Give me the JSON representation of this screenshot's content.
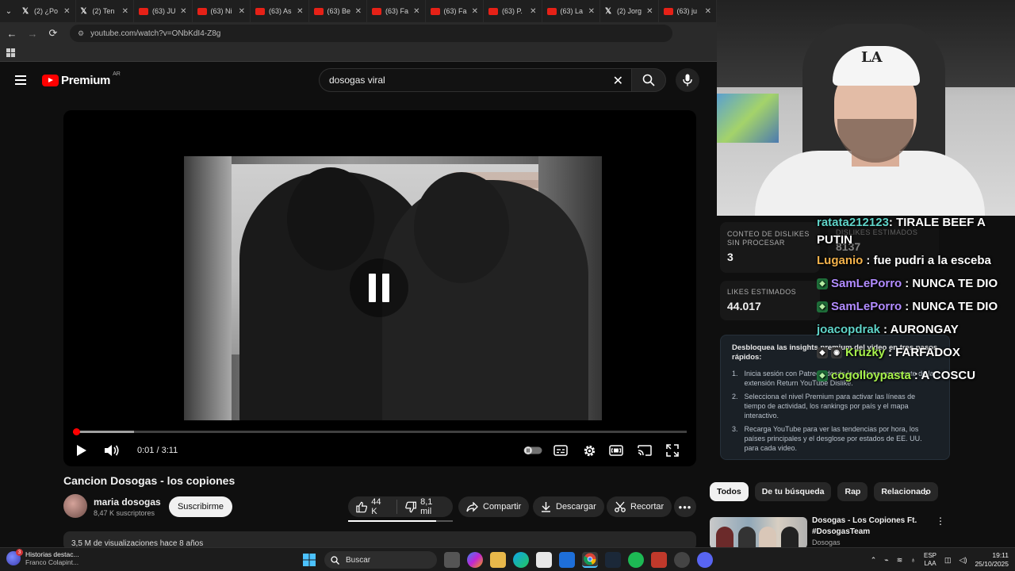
{
  "browser": {
    "tabs": [
      {
        "icon": "x-icon",
        "label": "(2) ¿Po"
      },
      {
        "icon": "x-icon",
        "label": "(2) Ten"
      },
      {
        "icon": "youtube-icon",
        "label": "(63) JU"
      },
      {
        "icon": "youtube-icon",
        "label": "(63) Ni"
      },
      {
        "icon": "youtube-icon",
        "label": "(63) As"
      },
      {
        "icon": "youtube-icon",
        "label": "(63) Be"
      },
      {
        "icon": "youtube-icon",
        "label": "(63) Fa"
      },
      {
        "icon": "youtube-icon",
        "label": "(63) Fa"
      },
      {
        "icon": "youtube-icon",
        "label": "(63) P."
      },
      {
        "icon": "youtube-icon",
        "label": "(63) La"
      },
      {
        "icon": "x-icon",
        "label": "(2) Jorg"
      },
      {
        "icon": "youtube-icon",
        "label": "(63) ju"
      }
    ],
    "url": "youtube.com/watch?v=ONbKdI4-Z8g"
  },
  "youtube": {
    "logo_text": "Premium",
    "country_code": "AR",
    "search_query": "dosogas viral"
  },
  "player": {
    "time_current": "0:01",
    "time_separator": " / ",
    "time_total": "3:11",
    "played_fraction": 0.005,
    "loaded_fraction": 0.1
  },
  "video": {
    "title": "Cancion Dosogas - los copiones",
    "channel_name": "maria dosogas",
    "subscribers": "8,47 K suscriptores",
    "subscribe_label": "Suscribirme",
    "likes": "44 K",
    "dislikes": "8,1 mil",
    "like_ratio": 0.84,
    "share_label": "Compartir",
    "download_label": "Descargar",
    "clip_label": "Recortar",
    "views_line": "3,5 M de visualizaciones hace 8 años"
  },
  "stats_panel": {
    "raw_dislikes_label": "CONTEO DE DISLIKES SIN PROCESAR",
    "raw_dislikes_value": "3",
    "est_dislikes_label": "DISLIKES ESTIMADOS",
    "est_dislikes_value": "8137",
    "est_likes_label": "LIKES ESTIMADOS",
    "est_likes_value": "44.017",
    "insights_heading": "Desbloquea las insights premium del video en tres pasos rápidos:",
    "insights_steps": [
      {
        "n": "1.",
        "text": "Inicia sesión con Patreon desde la ventana emergente de la extensión Return YouTube Dislike."
      },
      {
        "n": "2.",
        "text": "Selecciona el nivel Premium para activar las líneas de tiempo de actividad, los rankings por país y el mapa interactivo."
      },
      {
        "n": "3.",
        "text": "Recarga YouTube para ver las tendencias por hora, los países principales y el desglose por estados de EE. UU. para cada video."
      }
    ]
  },
  "chat": [
    {
      "user": "ratata212123",
      "user_color": "#5fd3c8",
      "message": ": TIRALE BEEF A PUTIN",
      "badge": ""
    },
    {
      "user": "Luganio",
      "user_color": "#f3b24b",
      "message": ": fue pudri a la esceba",
      "badge": ""
    },
    {
      "user": "SamLePorro",
      "user_color": "#b28cff",
      "message": ": NUNCA TE DIO",
      "badge": "green"
    },
    {
      "user": "SamLePorro",
      "user_color": "#b28cff",
      "message": ": NUNCA TE DIO",
      "badge": "green"
    },
    {
      "user": "joacopdrak",
      "user_color": "#5fd3c8",
      "message": ": AURONGAY",
      "badge": ""
    },
    {
      "user": "Kruzky",
      "user_color": "#a6f04c",
      "message": ": FARFADOX",
      "badge": "double"
    },
    {
      "user": "cogolloypasta",
      "user_color": "#a6f04c",
      "message": ": A COSCU",
      "badge": "green"
    }
  ],
  "chips": [
    "Todos",
    "De tu búsqueda",
    "Rap",
    "Relacionado"
  ],
  "recommendation": {
    "title": "Dosogas - Los Copiones Ft. #DosogasTeam",
    "channel": "Dosogas"
  },
  "taskbar": {
    "widget_title": "Historias destac...",
    "widget_subtitle": "Franco Colapint...",
    "widget_badge": "3",
    "search_label": "Buscar",
    "lang_top": "ESP",
    "lang_bottom": "LAA",
    "time": "19:11",
    "date": "25/10/2025"
  }
}
